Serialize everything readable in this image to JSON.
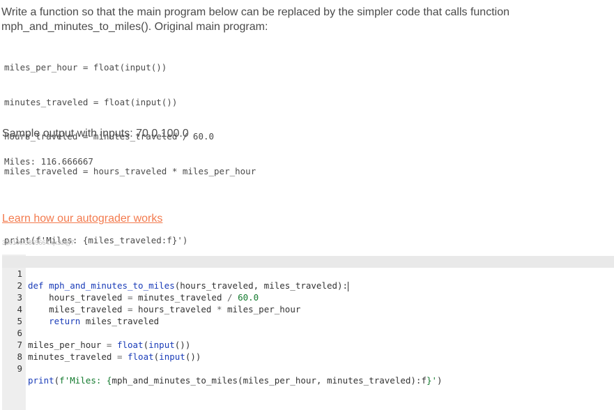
{
  "prompt": {
    "text_line1": "Write a function so that the main program below can be replaced by the simpler code that calls function",
    "text_line2": "mph_and_minutes_to_miles(). Original main program:"
  },
  "original_program": [
    "miles_per_hour = float(input())",
    "minutes_traveled = float(input())",
    "hours_traveled = minutes_traveled / 60.0",
    "miles_traveled = hours_traveled * miles_per_hour",
    "",
    "print(f'Miles: {miles_traveled:f}')"
  ],
  "sample": {
    "label": "Sample output with inputs: 70.0 100.0",
    "output": "Miles: 116.666667"
  },
  "link": {
    "text": "Learn how our autograder works"
  },
  "zy_id": "360100.3865664.qx3zqy7",
  "editor": {
    "line_numbers": [
      "1",
      "2",
      "3",
      "4",
      "5",
      "6",
      "7",
      "8",
      "9"
    ]
  },
  "colors": {
    "keyword": "#1a3cb8",
    "number_string": "#137a2e",
    "link": "#f37a4d",
    "gutter": "#eeeeee"
  }
}
